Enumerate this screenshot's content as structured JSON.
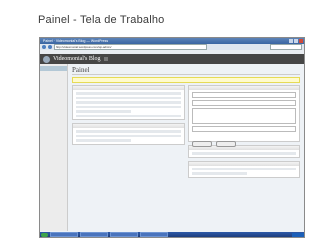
{
  "slide": {
    "title": "Painel - Tela de Trabalho"
  },
  "browser": {
    "title": "Painel · Videomonial's Blog — WordPress",
    "url": "http://videomonial.wordpress.com/wp-admin/"
  },
  "wp": {
    "blog_title": "Videomonial's Blog",
    "page_title": "Painel"
  }
}
